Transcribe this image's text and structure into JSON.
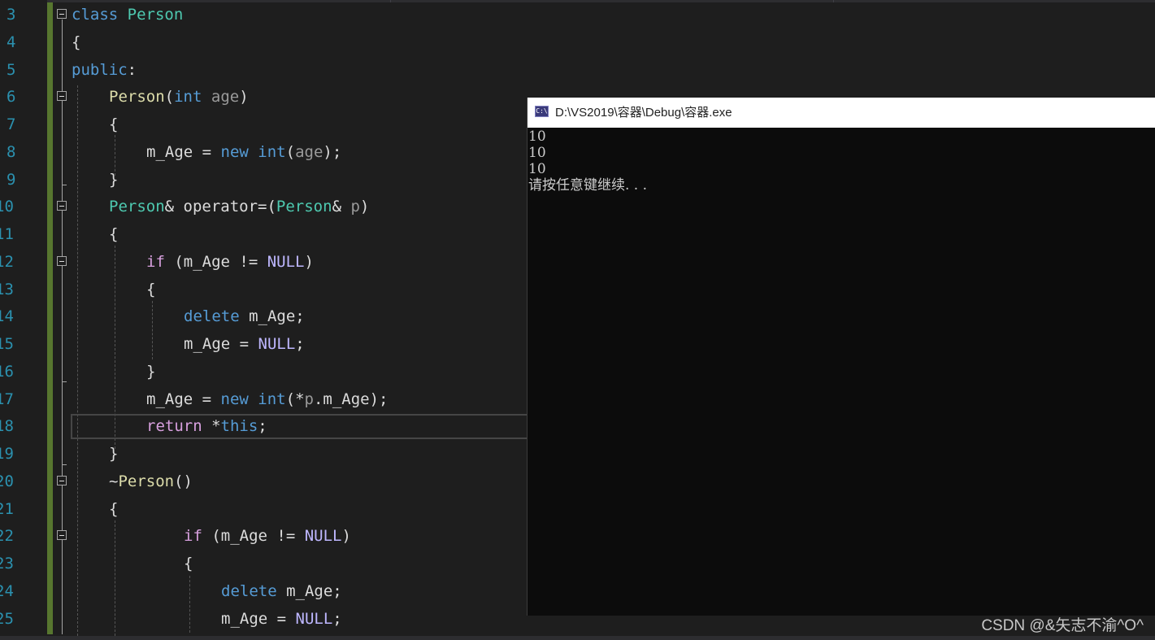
{
  "editor": {
    "lines": [
      {
        "num": "3",
        "tokens": [
          {
            "c": "k",
            "t": "class"
          },
          {
            "c": "m",
            "t": " "
          },
          {
            "c": "t",
            "t": "Person"
          }
        ]
      },
      {
        "num": "4",
        "tokens": [
          {
            "c": "m",
            "t": "{"
          }
        ]
      },
      {
        "num": "5",
        "tokens": [
          {
            "c": "k",
            "t": "public"
          },
          {
            "c": "m",
            "t": ":"
          }
        ]
      },
      {
        "num": "6",
        "tokens": [
          {
            "c": "f",
            "t": "Person"
          },
          {
            "c": "m",
            "t": "("
          },
          {
            "c": "k",
            "t": "int"
          },
          {
            "c": "m",
            "t": " "
          },
          {
            "c": "p",
            "t": "age"
          },
          {
            "c": "m",
            "t": ")"
          }
        ]
      },
      {
        "num": "7",
        "tokens": [
          {
            "c": "m",
            "t": "{"
          }
        ]
      },
      {
        "num": "8",
        "tokens": [
          {
            "c": "m",
            "t": "m_Age = "
          },
          {
            "c": "k",
            "t": "new"
          },
          {
            "c": "m",
            "t": " "
          },
          {
            "c": "k",
            "t": "int"
          },
          {
            "c": "m",
            "t": "("
          },
          {
            "c": "p",
            "t": "age"
          },
          {
            "c": "m",
            "t": ");"
          }
        ]
      },
      {
        "num": "9",
        "tokens": [
          {
            "c": "m",
            "t": "}"
          }
        ]
      },
      {
        "num": "10",
        "tokens": [
          {
            "c": "t",
            "t": "Person"
          },
          {
            "c": "m",
            "t": "& operator=("
          },
          {
            "c": "t",
            "t": "Person"
          },
          {
            "c": "m",
            "t": "& "
          },
          {
            "c": "p",
            "t": "p"
          },
          {
            "c": "m",
            "t": ")"
          }
        ]
      },
      {
        "num": "11",
        "tokens": [
          {
            "c": "m",
            "t": "{"
          }
        ]
      },
      {
        "num": "12",
        "tokens": [
          {
            "c": "kc",
            "t": "if"
          },
          {
            "c": "m",
            "t": " (m_Age != "
          },
          {
            "c": "mac",
            "t": "NULL"
          },
          {
            "c": "m",
            "t": ")"
          }
        ]
      },
      {
        "num": "13",
        "tokens": [
          {
            "c": "m",
            "t": "{"
          }
        ]
      },
      {
        "num": "14",
        "tokens": [
          {
            "c": "k",
            "t": "delete"
          },
          {
            "c": "m",
            "t": " m_Age;"
          }
        ]
      },
      {
        "num": "15",
        "tokens": [
          {
            "c": "m",
            "t": "m_Age = "
          },
          {
            "c": "mac",
            "t": "NULL"
          },
          {
            "c": "m",
            "t": ";"
          }
        ]
      },
      {
        "num": "16",
        "tokens": [
          {
            "c": "m",
            "t": "}"
          }
        ]
      },
      {
        "num": "17",
        "tokens": [
          {
            "c": "m",
            "t": "m_Age = "
          },
          {
            "c": "k",
            "t": "new"
          },
          {
            "c": "m",
            "t": " "
          },
          {
            "c": "k",
            "t": "int"
          },
          {
            "c": "m",
            "t": "(*"
          },
          {
            "c": "p",
            "t": "p"
          },
          {
            "c": "m",
            "t": ".m_Age);"
          }
        ]
      },
      {
        "num": "18",
        "tokens": [
          {
            "c": "kc",
            "t": "return"
          },
          {
            "c": "m",
            "t": " *"
          },
          {
            "c": "k",
            "t": "this"
          },
          {
            "c": "m",
            "t": ";"
          }
        ]
      },
      {
        "num": "19",
        "tokens": [
          {
            "c": "m",
            "t": "}"
          }
        ]
      },
      {
        "num": "20",
        "tokens": [
          {
            "c": "m",
            "t": "~"
          },
          {
            "c": "f",
            "t": "Person"
          },
          {
            "c": "m",
            "t": "()"
          }
        ]
      },
      {
        "num": "21",
        "tokens": [
          {
            "c": "m",
            "t": "{"
          }
        ]
      },
      {
        "num": "22",
        "tokens": [
          {
            "c": "kc",
            "t": "if"
          },
          {
            "c": "m",
            "t": " (m_Age != "
          },
          {
            "c": "mac",
            "t": "NULL"
          },
          {
            "c": "m",
            "t": ")"
          }
        ]
      },
      {
        "num": "23",
        "tokens": [
          {
            "c": "m",
            "t": "{"
          }
        ]
      },
      {
        "num": "24",
        "tokens": [
          {
            "c": "k",
            "t": "delete"
          },
          {
            "c": "m",
            "t": " m_Age;"
          }
        ]
      },
      {
        "num": "25",
        "tokens": [
          {
            "c": "m",
            "t": "m_Age = "
          },
          {
            "c": "mac",
            "t": "NULL"
          },
          {
            "c": "m",
            "t": ";"
          }
        ]
      }
    ]
  },
  "console": {
    "icon_label": "C:\\",
    "title": "D:\\VS2019\\容器\\Debug\\容器.exe",
    "output": [
      "10",
      "10",
      "10",
      "请按任意键继续. . ."
    ]
  },
  "watermark": "CSDN @&矢志不渝^O^",
  "colors": {
    "keyword": "#569cd6",
    "control_keyword": "#d8a0df",
    "type": "#4ec9b0",
    "function": "#dcdcaa",
    "parameter": "#9a9a9a",
    "macro": "#beb7ff",
    "line_number": "#2b91af",
    "change_bar": "#57762f"
  }
}
